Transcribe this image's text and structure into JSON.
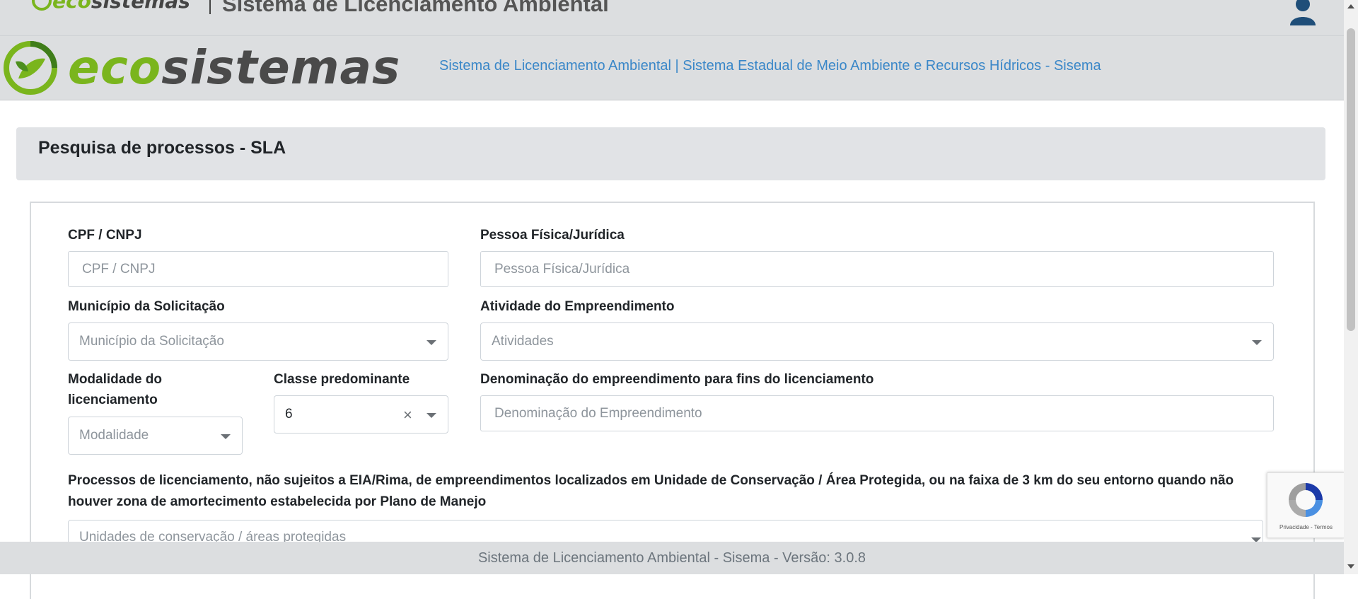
{
  "header": {
    "brand_eco": "eco",
    "brand_sistemas": "sistemas",
    "title": "Sistema de Licenciamento Ambiental",
    "subtitle": "Sistema de Licenciamento Ambiental | Sistema Estadual de Meio Ambiente e Recursos Hídricos - Sisema",
    "user_icon": "user-icon"
  },
  "page": {
    "title": "Pesquisa de processos - SLA"
  },
  "form": {
    "cpf_cnpj": {
      "label": "CPF / CNPJ",
      "placeholder": "CPF / CNPJ",
      "value": ""
    },
    "pessoa": {
      "label": "Pessoa Física/Jurídica",
      "placeholder": "Pessoa Física/Jurídica",
      "value": ""
    },
    "municipio": {
      "label": "Município da Solicitação",
      "placeholder": "Município da Solicitação"
    },
    "atividade": {
      "label": "Atividade do Empreendimento",
      "placeholder": "Atividades"
    },
    "modalidade": {
      "label": "Modalidade do licenciamento",
      "placeholder": "Modalidade"
    },
    "classe": {
      "label": "Classe predominante",
      "value": "6"
    },
    "denominacao": {
      "label": "Denominação do empreendimento para fins do licenciamento",
      "placeholder": "Denominação do Empreendimento",
      "value": ""
    },
    "unidades": {
      "label": "Processos de licenciamento, não sujeitos a EIA/Rima, de empreendimentos localizados em Unidade de Conservação / Área Protegida, ou na faixa de 3 km do seu entorno quando não houver zona de amortecimento estabelecida por Plano de Manejo",
      "placeholder": "Unidades de conservação / áreas protegidas"
    }
  },
  "recaptcha": {
    "links": "Privacidade - Termos"
  },
  "footer": {
    "text": "Sistema de Licenciamento Ambiental - Sisema - Versão: 3.0.8"
  },
  "colors": {
    "brand_green": "#7ab51d",
    "brand_gray": "#4a4a4a",
    "link_blue": "#3a87c8",
    "header_bg": "#dcdee0"
  }
}
